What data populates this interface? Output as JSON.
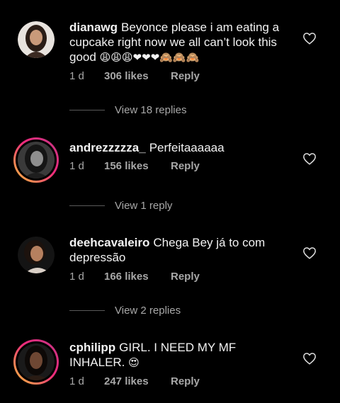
{
  "comments": [
    {
      "username": "dianawg",
      "text": "Beyonce please i am eating a cupcake right now we all can’t look this good",
      "emoji": "😩😩😩❤❤❤🙈🙈🙈",
      "time": "1 d",
      "likes": "306 likes",
      "reply": "Reply",
      "view_replies": "View 18 replies"
    },
    {
      "username": "andrezzzzza_",
      "text": "Perfeitaaaaaa",
      "emoji": "",
      "time": "1 d",
      "likes": "156 likes",
      "reply": "Reply",
      "view_replies": "View 1 reply"
    },
    {
      "username": "deehcavaleiro",
      "text": "Chega Bey já to com depressão",
      "emoji": "",
      "time": "1 d",
      "likes": "166 likes",
      "reply": "Reply",
      "view_replies": "View 2 replies"
    },
    {
      "username": "cphilipp",
      "text": "GIRL. I NEED MY MF INHALER.",
      "emoji": "😍",
      "time": "1 d",
      "likes": "247 likes",
      "reply": "Reply"
    }
  ],
  "colors": {
    "background": "#000000",
    "text": "#f2f2f2",
    "muted": "#a8a8a8",
    "story_ring_start": "#f9c53b",
    "story_ring_end": "#c13584"
  },
  "icons": {
    "like": "heart-outline-icon"
  }
}
